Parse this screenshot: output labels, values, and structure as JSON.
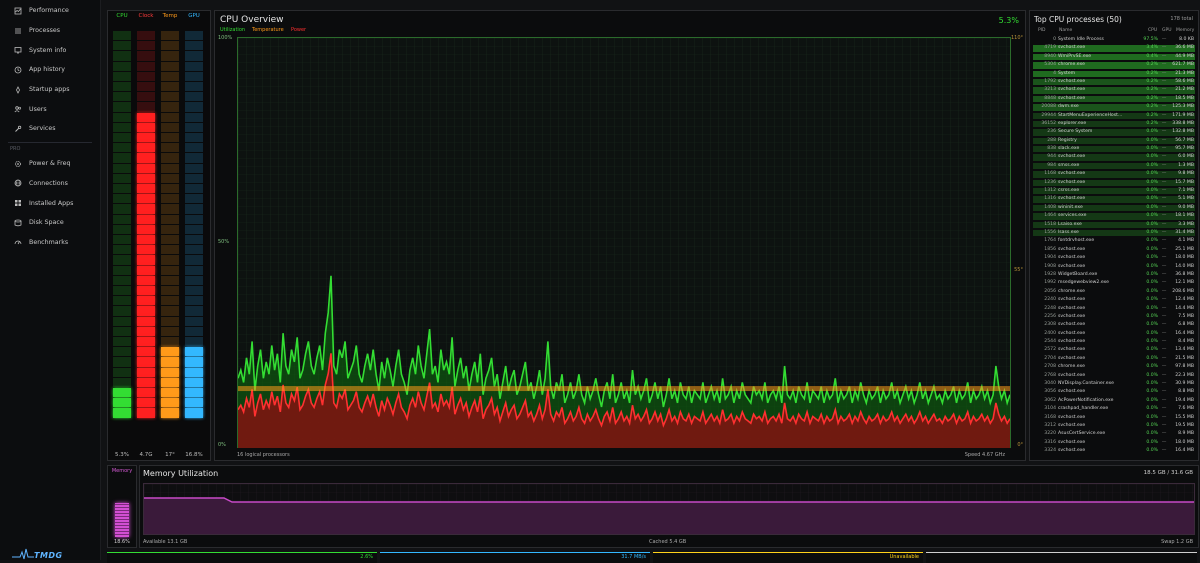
{
  "sidebar": {
    "items": [
      {
        "label": "Performance",
        "icon": "performance-icon"
      },
      {
        "label": "Processes",
        "icon": "list-icon"
      },
      {
        "label": "System info",
        "icon": "info-icon"
      },
      {
        "label": "App history",
        "icon": "history-icon"
      },
      {
        "label": "Startup apps",
        "icon": "rocket-icon"
      },
      {
        "label": "Users",
        "icon": "users-icon"
      },
      {
        "label": "Services",
        "icon": "wrench-icon"
      }
    ],
    "pro_label": "PRO",
    "pro_items": [
      {
        "label": "Power & Freq",
        "icon": "gear-icon"
      },
      {
        "label": "Connections",
        "icon": "network-icon"
      },
      {
        "label": "Installed Apps",
        "icon": "apps-icon"
      },
      {
        "label": "Disk Space",
        "icon": "disk-icon"
      },
      {
        "label": "Benchmarks",
        "icon": "gauge-icon"
      }
    ],
    "logo_text": "TMDG"
  },
  "gauges": [
    {
      "label": "CPU",
      "value": "5.3%",
      "level": 0.075,
      "color": "#33dd33",
      "label_color": "#33dd33"
    },
    {
      "label": "Clock",
      "value": "4.7G",
      "level": 0.79,
      "color": "#ff2020",
      "label_color": "#ff3b3b"
    },
    {
      "label": "Temp",
      "value": "17°",
      "level": 0.18,
      "color": "#ff9a1a",
      "label_color": "#ff9a1a"
    },
    {
      "label": "GPU",
      "value": "16.8%",
      "level": 0.18,
      "color": "#33b8ff",
      "label_color": "#33b8ff"
    }
  ],
  "cpu": {
    "title": "CPU Overview",
    "percent": "5.3%",
    "legend": [
      {
        "label": "Utilization",
        "color": "#33dd33"
      },
      {
        "label": "Temperature",
        "color": "#ff9a1a"
      },
      {
        "label": "Power",
        "color": "#ff3030"
      }
    ],
    "left_axis": [
      "100%",
      "50%",
      "0%"
    ],
    "right_axis": [
      "110°",
      "55°",
      "0°"
    ],
    "footer_left": "16 logical processors",
    "footer_right": "Speed 4.67 GHz",
    "utilization_series": [
      17,
      19,
      16,
      22,
      18,
      26,
      14,
      20,
      24,
      17,
      21,
      18,
      25,
      19,
      23,
      16,
      28,
      20,
      18,
      24,
      21,
      27,
      17,
      19,
      23,
      26,
      20,
      18,
      22,
      25,
      19,
      28,
      33,
      42,
      20,
      18,
      24,
      22,
      26,
      17,
      19,
      21,
      25,
      18,
      16,
      20,
      23,
      19,
      24,
      18,
      14,
      21,
      17,
      22,
      19,
      15,
      20,
      24,
      18,
      16,
      13,
      19,
      22,
      18,
      25,
      20,
      17,
      23,
      29,
      18,
      20,
      16,
      24,
      19,
      21,
      18,
      27,
      15,
      19,
      22,
      17,
      20,
      14,
      18,
      21,
      16,
      23,
      13,
      17,
      19,
      22,
      15,
      18,
      12,
      16,
      20,
      14,
      17,
      19,
      13,
      15,
      18,
      21,
      14,
      16,
      12,
      15,
      19,
      13,
      17,
      26,
      15,
      12,
      16,
      14,
      18,
      11,
      13,
      16,
      12,
      14,
      18,
      13,
      11,
      15,
      12,
      14,
      17,
      13,
      10,
      14,
      16,
      12,
      18,
      11,
      13,
      16,
      12,
      14,
      11,
      19,
      13,
      15,
      12,
      14,
      17,
      11,
      13,
      16,
      12,
      15,
      10,
      13,
      17,
      12,
      14,
      11,
      16,
      13,
      12,
      15,
      11,
      14,
      13,
      12,
      16,
      11,
      13,
      15,
      12,
      14,
      11,
      17,
      12,
      13,
      15,
      11,
      14,
      12,
      16,
      13,
      12,
      11,
      15,
      13,
      14,
      12,
      16,
      11,
      13,
      14,
      12,
      15,
      11,
      20,
      13,
      12,
      14,
      11,
      15,
      13,
      12,
      16,
      11,
      14,
      13,
      12,
      15,
      11,
      14,
      12,
      13,
      17,
      11,
      14,
      12,
      13,
      15,
      11,
      14,
      12,
      16,
      13,
      11,
      14,
      12,
      13,
      15,
      11,
      14,
      12,
      13,
      16,
      12,
      14,
      11,
      13,
      15,
      12,
      14,
      11,
      13,
      16,
      12,
      14,
      11,
      13,
      15,
      12,
      13,
      11,
      14,
      12,
      13,
      15,
      11,
      14,
      12,
      13,
      16,
      11,
      14,
      12,
      13,
      15,
      12,
      14,
      11,
      13,
      20,
      15,
      12,
      14,
      11,
      13
    ],
    "temperature_level": 0.145,
    "power_ratio": 0.55
  },
  "processes": {
    "title": "Top CPU processes (50)",
    "total": "178 total",
    "headers": {
      "pid": "PID",
      "name": "Name",
      "cpu": "CPU",
      "gpu": "GPU",
      "memory": "Memory"
    },
    "rows": [
      {
        "pid": "0",
        "name": "System Idle Process",
        "cpu": "97.5%",
        "gpu": "—",
        "mem": "8.0 KB",
        "bar": 0
      },
      {
        "pid": "4719",
        "name": "svchost.exe",
        "cpu": "3.4%",
        "gpu": "—",
        "mem": "36.6 MB",
        "bar": 1
      },
      {
        "pid": "8940",
        "name": "WmiPrvSE.exe",
        "cpu": "0.4%",
        "gpu": "—",
        "mem": "44.9 MB",
        "bar": 1
      },
      {
        "pid": "5304",
        "name": "chrome.exe",
        "cpu": "0.2%",
        "gpu": "—",
        "mem": "621.7 MB",
        "bar": 1
      },
      {
        "pid": "4",
        "name": "System",
        "cpu": "0.2%",
        "gpu": "—",
        "mem": "21.3 MB",
        "bar": 1
      },
      {
        "pid": "1792",
        "name": "svchost.exe",
        "cpu": "0.2%",
        "gpu": "—",
        "mem": "58.6 MB",
        "bar": 0.7
      },
      {
        "pid": "3213",
        "name": "svchost.exe",
        "cpu": "0.2%",
        "gpu": "—",
        "mem": "21.2 MB",
        "bar": 0.7
      },
      {
        "pid": "8848",
        "name": "svchost.exe",
        "cpu": "0.2%",
        "gpu": "—",
        "mem": "18.5 MB",
        "bar": 0.7
      },
      {
        "pid": "20088",
        "name": "dwm.exe",
        "cpu": "0.2%",
        "gpu": "—",
        "mem": "125.3 MB",
        "bar": 0.7
      },
      {
        "pid": "29944",
        "name": "StartMenuExperienceHost...",
        "cpu": "0.2%",
        "gpu": "—",
        "mem": "171.9 MB",
        "bar": 0.3
      },
      {
        "pid": "36152",
        "name": "explorer.exe",
        "cpu": "0.2%",
        "gpu": "—",
        "mem": "338.8 MB",
        "bar": 0.3
      },
      {
        "pid": "236",
        "name": "Secure System",
        "cpu": "0.0%",
        "gpu": "—",
        "mem": "132.8 MB",
        "bar": 0.3
      },
      {
        "pid": "288",
        "name": "Registry",
        "cpu": "0.0%",
        "gpu": "—",
        "mem": "56.7 MB",
        "bar": 0.3
      },
      {
        "pid": "838",
        "name": "slack.exe",
        "cpu": "0.0%",
        "gpu": "—",
        "mem": "95.7 MB",
        "bar": 0.3
      },
      {
        "pid": "944",
        "name": "svchost.exe",
        "cpu": "0.0%",
        "gpu": "—",
        "mem": "6.0 MB",
        "bar": 0.3
      },
      {
        "pid": "984",
        "name": "smss.exe",
        "cpu": "0.0%",
        "gpu": "—",
        "mem": "1.3 MB",
        "bar": 0.3
      },
      {
        "pid": "1168",
        "name": "svchost.exe",
        "cpu": "0.0%",
        "gpu": "—",
        "mem": "9.8 MB",
        "bar": 0.3
      },
      {
        "pid": "1236",
        "name": "svchost.exe",
        "cpu": "0.0%",
        "gpu": "—",
        "mem": "15.7 MB",
        "bar": 0.3
      },
      {
        "pid": "1312",
        "name": "csrss.exe",
        "cpu": "0.0%",
        "gpu": "—",
        "mem": "7.1 MB",
        "bar": 0.3
      },
      {
        "pid": "1316",
        "name": "svchost.exe",
        "cpu": "0.0%",
        "gpu": "—",
        "mem": "5.1 MB",
        "bar": 0.3
      },
      {
        "pid": "1408",
        "name": "wininit.exe",
        "cpu": "0.0%",
        "gpu": "—",
        "mem": "9.0 MB",
        "bar": 0.3
      },
      {
        "pid": "1464",
        "name": "services.exe",
        "cpu": "0.0%",
        "gpu": "—",
        "mem": "18.1 MB",
        "bar": 0.3
      },
      {
        "pid": "1518",
        "name": "Lsaiso.exe",
        "cpu": "0.0%",
        "gpu": "—",
        "mem": "3.3 MB",
        "bar": 0.3
      },
      {
        "pid": "1556",
        "name": "lsass.exe",
        "cpu": "0.0%",
        "gpu": "—",
        "mem": "31.4 MB",
        "bar": 0.3
      },
      {
        "pid": "1764",
        "name": "fontdrvhost.exe",
        "cpu": "0.0%",
        "gpu": "—",
        "mem": "4.1 MB",
        "bar": 0
      },
      {
        "pid": "1856",
        "name": "svchost.exe",
        "cpu": "0.0%",
        "gpu": "—",
        "mem": "25.1 MB",
        "bar": 0
      },
      {
        "pid": "1904",
        "name": "svchost.exe",
        "cpu": "0.0%",
        "gpu": "—",
        "mem": "18.0 MB",
        "bar": 0
      },
      {
        "pid": "1908",
        "name": "svchost.exe",
        "cpu": "0.0%",
        "gpu": "—",
        "mem": "14.0 MB",
        "bar": 0
      },
      {
        "pid": "1928",
        "name": "WidgetBoard.exe",
        "cpu": "0.0%",
        "gpu": "—",
        "mem": "36.8 MB",
        "bar": 0
      },
      {
        "pid": "1992",
        "name": "msedgewebview2.exe",
        "cpu": "0.0%",
        "gpu": "—",
        "mem": "12.1 MB",
        "bar": 0
      },
      {
        "pid": "2056",
        "name": "chrome.exe",
        "cpu": "0.0%",
        "gpu": "—",
        "mem": "208.6 MB",
        "bar": 0
      },
      {
        "pid": "2240",
        "name": "svchost.exe",
        "cpu": "0.0%",
        "gpu": "—",
        "mem": "12.4 MB",
        "bar": 0
      },
      {
        "pid": "2248",
        "name": "svchost.exe",
        "cpu": "0.0%",
        "gpu": "—",
        "mem": "14.4 MB",
        "bar": 0
      },
      {
        "pid": "2256",
        "name": "svchost.exe",
        "cpu": "0.0%",
        "gpu": "—",
        "mem": "7.5 MB",
        "bar": 0
      },
      {
        "pid": "2308",
        "name": "svchost.exe",
        "cpu": "0.0%",
        "gpu": "—",
        "mem": "6.8 MB",
        "bar": 0
      },
      {
        "pid": "2400",
        "name": "svchost.exe",
        "cpu": "0.0%",
        "gpu": "—",
        "mem": "16.4 MB",
        "bar": 0
      },
      {
        "pid": "2544",
        "name": "svchost.exe",
        "cpu": "0.0%",
        "gpu": "—",
        "mem": "8.4 MB",
        "bar": 0
      },
      {
        "pid": "2572",
        "name": "svchost.exe",
        "cpu": "0.0%",
        "gpu": "—",
        "mem": "13.4 MB",
        "bar": 0
      },
      {
        "pid": "2704",
        "name": "svchost.exe",
        "cpu": "0.0%",
        "gpu": "—",
        "mem": "21.5 MB",
        "bar": 0
      },
      {
        "pid": "2708",
        "name": "chrome.exe",
        "cpu": "0.0%",
        "gpu": "—",
        "mem": "97.8 MB",
        "bar": 0
      },
      {
        "pid": "2768",
        "name": "svchost.exe",
        "cpu": "0.0%",
        "gpu": "—",
        "mem": "22.3 MB",
        "bar": 0
      },
      {
        "pid": "3040",
        "name": "NVDisplay.Container.exe",
        "cpu": "0.0%",
        "gpu": "—",
        "mem": "30.9 MB",
        "bar": 0
      },
      {
        "pid": "3056",
        "name": "svchost.exe",
        "cpu": "0.0%",
        "gpu": "—",
        "mem": "8.8 MB",
        "bar": 0
      },
      {
        "pid": "3062",
        "name": "AcPowerNotification.exe",
        "cpu": "0.0%",
        "gpu": "—",
        "mem": "19.4 MB",
        "bar": 0
      },
      {
        "pid": "3104",
        "name": "crashpad_handler.exe",
        "cpu": "0.0%",
        "gpu": "—",
        "mem": "7.6 MB",
        "bar": 0
      },
      {
        "pid": "3168",
        "name": "svchost.exe",
        "cpu": "0.0%",
        "gpu": "—",
        "mem": "15.5 MB",
        "bar": 0
      },
      {
        "pid": "3212",
        "name": "svchost.exe",
        "cpu": "0.0%",
        "gpu": "—",
        "mem": "19.5 MB",
        "bar": 0
      },
      {
        "pid": "3220",
        "name": "AsusCertService.exe",
        "cpu": "0.0%",
        "gpu": "—",
        "mem": "8.9 MB",
        "bar": 0
      },
      {
        "pid": "3316",
        "name": "svchost.exe",
        "cpu": "0.0%",
        "gpu": "—",
        "mem": "18.0 MB",
        "bar": 0
      },
      {
        "pid": "3324",
        "name": "svchost.exe",
        "cpu": "0.0%",
        "gpu": "—",
        "mem": "16.4 MB",
        "bar": 0
      }
    ]
  },
  "memory": {
    "gauge_label": "Memory",
    "gauge_value": "18.6%",
    "gauge_level": 0.6,
    "title": "Memory Utilization",
    "usage": "18.5 GB / 31.6 GB",
    "available": "Available 13.1 GB",
    "cached": "Cached 5.4 GB",
    "swap": "Swap 1.2 GB",
    "series_start": 0.72,
    "series_level": 0.64
  },
  "bottom_strip": [
    {
      "text": "2.6%",
      "color": "#33dd33"
    },
    {
      "text": "31.7 MB/s",
      "color": "#33b8ff"
    },
    {
      "text": "Unavailable",
      "color": "#ffd21a"
    },
    {
      "text": "",
      "color": "#cfcfcf"
    }
  ]
}
